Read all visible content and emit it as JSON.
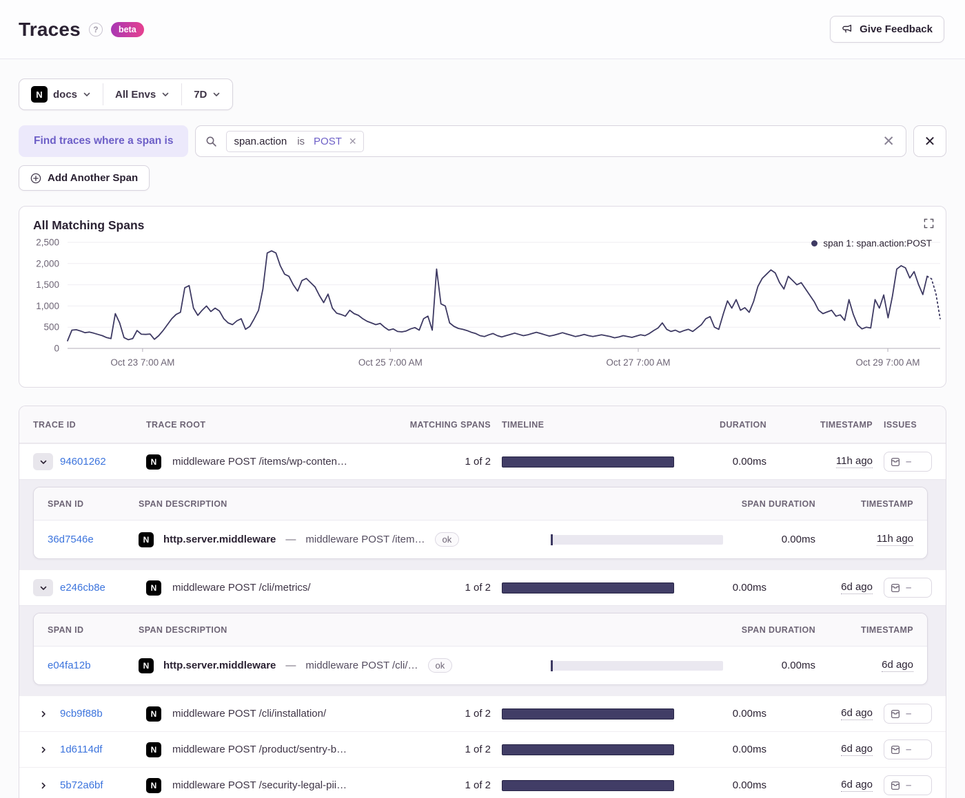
{
  "page": {
    "title": "Traces",
    "beta_label": "beta",
    "feedback_label": "Give Feedback"
  },
  "filters": {
    "project": "docs",
    "environment": "All Envs",
    "period": "7D"
  },
  "span_query": {
    "label": "Find traces where a span is",
    "token": {
      "key": "span.action",
      "op": "is",
      "value": "POST"
    },
    "add_button_label": "Add Another Span"
  },
  "chart_data": {
    "type": "line",
    "title": "All Matching Spans",
    "ylim": [
      0,
      2500
    ],
    "yticks": [
      0,
      500,
      1000,
      1500,
      2000,
      2500
    ],
    "grid": "horizontal",
    "legend_position": "top-right",
    "xticks": [
      {
        "label": "Oct 23 7:00 AM",
        "pos": 0.086
      },
      {
        "label": "Oct 25 7:00 AM",
        "pos": 0.37
      },
      {
        "label": "Oct 27 7:00 AM",
        "pos": 0.654
      },
      {
        "label": "Oct 29 7:00 AM",
        "pos": 0.94
      }
    ],
    "series": [
      {
        "name": "span 1: span.action:POST",
        "color": "#3e3a63",
        "dashed_tail_points": 3,
        "values": [
          180,
          430,
          440,
          410,
          370,
          385,
          360,
          330,
          300,
          255,
          230,
          820,
          600,
          255,
          205,
          230,
          420,
          335,
          330,
          340,
          215,
          300,
          420,
          560,
          700,
          800,
          850,
          1430,
          1480,
          950,
          780,
          900,
          1000,
          870,
          950,
          880,
          700,
          600,
          560,
          650,
          700,
          450,
          520,
          700,
          900,
          1400,
          2250,
          2300,
          2250,
          1950,
          1750,
          1700,
          1500,
          1350,
          1600,
          1650,
          1550,
          1450,
          1250,
          1080,
          1280,
          950,
          830,
          800,
          760,
          900,
          820,
          780,
          700,
          640,
          600,
          560,
          590,
          500,
          430,
          460,
          400,
          390,
          410,
          460,
          490,
          430,
          700,
          760,
          430,
          1870,
          1050,
          1000,
          600,
          520,
          470,
          450,
          420,
          380,
          350,
          300,
          280,
          320,
          350,
          300,
          270,
          300,
          330,
          360,
          330,
          300,
          320,
          350,
          380,
          350,
          320,
          290,
          310,
          340,
          370,
          340,
          310,
          280,
          300,
          330,
          300,
          280,
          300,
          320,
          300,
          280,
          250,
          270,
          300,
          280,
          260,
          290,
          320,
          300,
          350,
          420,
          480,
          600,
          450,
          400,
          430,
          380,
          420,
          450,
          400,
          480,
          560,
          700,
          750,
          500,
          450,
          800,
          1120,
          950,
          1150,
          900,
          960,
          850,
          1100,
          1460,
          1650,
          1750,
          1850,
          1780,
          1550,
          1400,
          1700,
          1600,
          1500,
          1550,
          1400,
          1250,
          1100,
          900,
          820,
          860,
          900,
          760,
          790,
          660,
          1150,
          800,
          550,
          460,
          500,
          480,
          1150,
          950,
          1260,
          720,
          1230,
          1870,
          1950,
          1900,
          1660,
          1810,
          1510,
          1270,
          1700,
          1640,
          1300,
          700
        ]
      }
    ]
  },
  "table": {
    "headers": {
      "trace_id": "TRACE ID",
      "trace_root": "TRACE ROOT",
      "matching_spans": "MATCHING SPANS",
      "timeline": "TIMELINE",
      "duration": "DURATION",
      "timestamp": "TIMESTAMP",
      "issues": "ISSUES"
    },
    "span_headers": {
      "span_id": "SPAN ID",
      "span_description": "SPAN DESCRIPTION",
      "span_duration": "SPAN DURATION",
      "timestamp": "TIMESTAMP"
    },
    "op_separator": "—",
    "issues_placeholder": "–",
    "rows": [
      {
        "trace_id": "94601262",
        "root": "middleware POST /items/wp-conten…",
        "matching": "1 of 2",
        "duration": "0.00ms",
        "timestamp": "11h ago",
        "spans": [
          {
            "span_id": "36d7546e",
            "op": "http.server.middleware",
            "desc": "middleware POST /item…",
            "status": "ok",
            "duration": "0.00ms",
            "timestamp": "11h ago"
          }
        ]
      },
      {
        "trace_id": "e246cb8e",
        "root": "middleware POST /cli/metrics/",
        "matching": "1 of 2",
        "duration": "0.00ms",
        "timestamp": "6d ago",
        "spans": [
          {
            "span_id": "e04fa12b",
            "op": "http.server.middleware",
            "desc": "middleware POST /cli/…",
            "status": "ok",
            "duration": "0.00ms",
            "timestamp": "6d ago"
          }
        ]
      },
      {
        "trace_id": "9cb9f88b",
        "root": "middleware POST /cli/installation/",
        "matching": "1 of 2",
        "duration": "0.00ms",
        "timestamp": "6d ago"
      },
      {
        "trace_id": "1d6114df",
        "root": "middleware POST /product/sentry-b…",
        "matching": "1 of 2",
        "duration": "0.00ms",
        "timestamp": "6d ago"
      },
      {
        "trace_id": "5b72a6bf",
        "root": "middleware POST /security-legal-pii…",
        "matching": "1 of 2",
        "duration": "0.00ms",
        "timestamp": "6d ago"
      }
    ]
  }
}
